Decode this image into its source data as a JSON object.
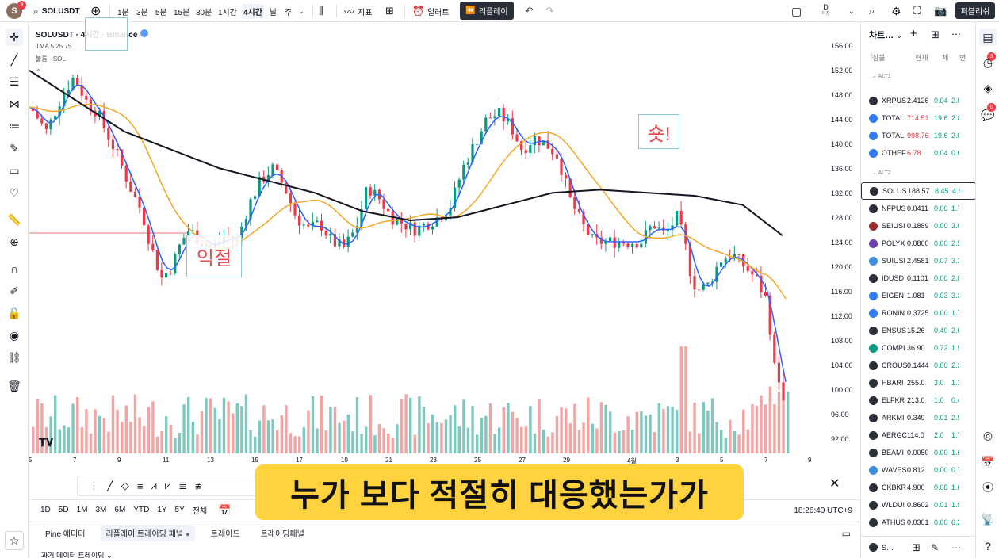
{
  "topbar": {
    "avatar_letter": "S",
    "avatar_badge": "8",
    "symbol": "SOLUSDT",
    "intervals": [
      "1분",
      "3분",
      "5분",
      "15분",
      "30분",
      "1시간",
      "4시간",
      "날",
      "주"
    ],
    "active_interval": "4시간",
    "indicators_label": "지표",
    "alerts_label": "얼러트",
    "replay_label": "리플레이",
    "layout_label": "D",
    "layout_sub": "저장",
    "publish_label": "퍼블리쉬"
  },
  "legend": {
    "title": "SOLUSDT · 4시간 · Binance",
    "indicator": "TMA 5 25 75",
    "volume": "볼륨 - SOL"
  },
  "notes": {
    "sell_note": "익절",
    "spike_note": "숏!"
  },
  "price_scale": [
    "156.00",
    "152.00",
    "148.00",
    "144.00",
    "140.00",
    "136.00",
    "132.00",
    "128.00",
    "124.00",
    "120.00",
    "116.00",
    "112.00",
    "108.00",
    "104.00",
    "100.00",
    "96.00",
    "92.00"
  ],
  "time_scale": [
    "5",
    "7",
    "9",
    "11",
    "13",
    "15",
    "17",
    "19",
    "21",
    "23",
    "25",
    "27",
    "29",
    "4월",
    "3",
    "5",
    "7",
    "9"
  ],
  "timebar": {
    "ranges": [
      "1D",
      "5D",
      "1M",
      "3M",
      "6M",
      "YTD",
      "1Y",
      "5Y",
      "전체"
    ],
    "clock": "18:26:40 UTC+9"
  },
  "bottom_tabs": [
    "Pine 에디터",
    "리플레이 트레이딩 패널",
    "트레이드",
    "트레이딩패널"
  ],
  "panel_title": "과거 데이터 트레이딩",
  "subtitle": "누가 보다 적절히 대응했는가가",
  "watchlist": {
    "title": "차트…",
    "columns": [
      "심볼",
      "현재",
      "체",
      "변"
    ],
    "sections": [
      "ALT1",
      "ALT2"
    ],
    "rows_alt1": [
      {
        "sym": "XRPUS",
        "last": "2.4126",
        "chg": "0.04",
        "pct": "2.0",
        "color": "#2a2e39",
        "lastColor": "#131722"
      },
      {
        "sym": "TOTAL",
        "last": "714.51",
        "chg": "19.6",
        "pct": "2.8",
        "color": "#3179f5",
        "lastColor": "#f23645"
      },
      {
        "sym": "TOTAL",
        "last": "998.76",
        "chg": "19.6",
        "pct": "2.0",
        "color": "#3179f5",
        "lastColor": "#f23645"
      },
      {
        "sym": "OTHEF",
        "last": "6.78",
        "chg": "0.04",
        "pct": "0.6",
        "color": "#3179f5",
        "lastColor": "#f23645"
      }
    ],
    "rows_alt2": [
      {
        "sym": "SOLUS",
        "last": "188.57",
        "chg": "8.45",
        "pct": "4.6",
        "color": "#2a2e39",
        "lastColor": "#131722"
      },
      {
        "sym": "NFPUS",
        "last": "0.0411",
        "chg": "0.00",
        "pct": "1.7",
        "color": "#2a2e39",
        "lastColor": "#131722"
      },
      {
        "sym": "SEIUSI",
        "last": "0.1889",
        "chg": "0.00",
        "pct": "3.0",
        "color": "#9c2b2b",
        "lastColor": "#131722"
      },
      {
        "sym": "POLYX",
        "last": "0.0860",
        "chg": "0.00",
        "pct": "2.5",
        "color": "#6c3fb0",
        "lastColor": "#131722"
      },
      {
        "sym": "SUIUSI",
        "last": "2.4581",
        "chg": "0.07",
        "pct": "3.2",
        "color": "#3a8de0",
        "lastColor": "#131722"
      },
      {
        "sym": "IDUSD",
        "last": "0.1101",
        "chg": "0.00",
        "pct": "2.8",
        "color": "#2a2e39",
        "lastColor": "#131722"
      },
      {
        "sym": "EIGEN",
        "last": "1.081",
        "chg": "0.03",
        "pct": "3.3",
        "color": "#3179f5",
        "lastColor": "#131722"
      },
      {
        "sym": "RONIN",
        "last": "0.3725",
        "chg": "0.00",
        "pct": "1.7",
        "color": "#3179f5",
        "lastColor": "#131722"
      },
      {
        "sym": "ENSUS",
        "last": "15.26",
        "chg": "0.40",
        "pct": "2.6",
        "color": "#2a2e39",
        "lastColor": "#131722"
      },
      {
        "sym": "COMPI",
        "last": "36.90",
        "chg": "0.72",
        "pct": "1.9",
        "color": "#089981",
        "lastColor": "#131722"
      },
      {
        "sym": "CROUS",
        "last": "0.1444",
        "chg": "0.00",
        "pct": "2.3",
        "color": "#2a2e39",
        "lastColor": "#131722"
      },
      {
        "sym": "HBARI",
        "last": "255.0",
        "chg": "3.0",
        "pct": "1.1",
        "color": "#2a2e39",
        "lastColor": "#131722"
      },
      {
        "sym": "ELFKR",
        "last": "213.0",
        "chg": "1.0",
        "pct": "0.4",
        "color": "#2a2e39",
        "lastColor": "#131722"
      },
      {
        "sym": "ARKMI",
        "last": "0.349",
        "chg": "0.01",
        "pct": "2.9",
        "color": "#2a2e39",
        "lastColor": "#131722"
      },
      {
        "sym": "AERGC",
        "last": "114.0",
        "chg": "2.0",
        "pct": "1.7",
        "color": "#2a2e39",
        "lastColor": "#131722"
      },
      {
        "sym": "BEAMI",
        "last": "0.0050",
        "chg": "0.00",
        "pct": "1.6",
        "color": "#2a2e39",
        "lastColor": "#131722"
      },
      {
        "sym": "WAVES",
        "last": "0.812",
        "chg": "0.00",
        "pct": "0.7",
        "color": "#3a8de0",
        "lastColor": "#131722"
      },
      {
        "sym": "CKBKR",
        "last": "4.900",
        "chg": "0.08",
        "pct": "1.6",
        "color": "#2a2e39",
        "lastColor": "#131722"
      },
      {
        "sym": "WLDU!",
        "last": "0.8602",
        "chg": "0.01",
        "pct": "1.8",
        "color": "#2a2e39",
        "lastColor": "#131722"
      },
      {
        "sym": "ATHUS",
        "last": "0.0301",
        "chg": "0.00",
        "pct": "6.2",
        "color": "#2a2e39",
        "lastColor": "#131722"
      }
    ],
    "footer_sym": "S…"
  },
  "right_badges": [
    "3",
    "6"
  ],
  "colors": {
    "up": "#089981",
    "down": "#f23645",
    "ma_fast": "#2962ff",
    "ma_mid": "#f5a623",
    "ma_slow": "#131722",
    "vol_up": "#7ec9bf",
    "vol_down": "#f5a3a3",
    "subtitle_bg": "#ffd23f"
  }
}
